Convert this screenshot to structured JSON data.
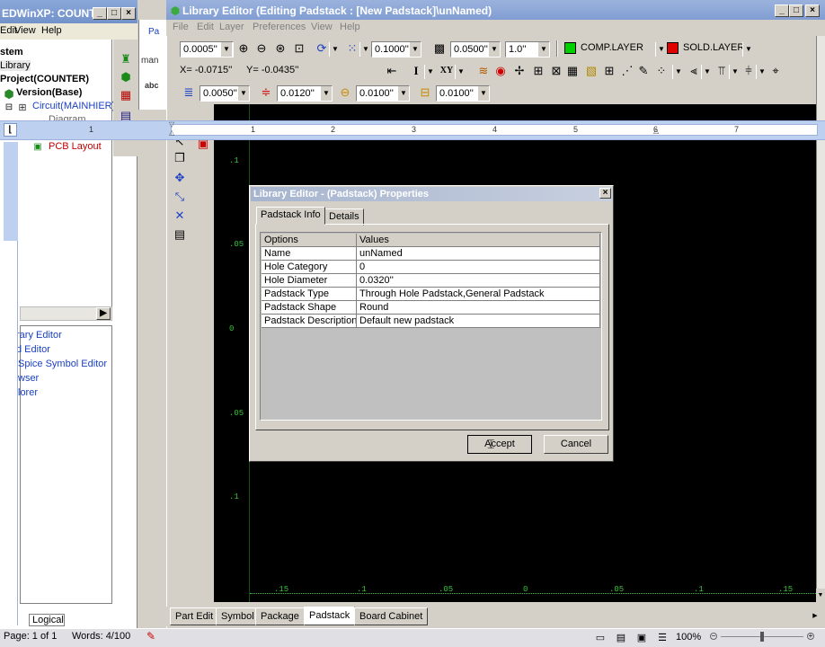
{
  "left_window": {
    "title": "EDWinXP: COUNTE...",
    "menu": [
      "Edit",
      "View",
      "Help"
    ],
    "tree": [
      {
        "label": "stem",
        "bold": true
      },
      {
        "label": "Library"
      },
      {
        "label": "Project(COUNTER)",
        "bold": true
      },
      {
        "label": "Version(Base)",
        "bold": true
      },
      {
        "label": "Circuit(MAINHIER)"
      },
      {
        "label": "Diagram"
      },
      {
        "label": "PCB Layout"
      }
    ],
    "tools": [
      {
        "label": "rary Editor"
      },
      {
        "label": "d Editor"
      },
      {
        "label": "Spice Symbol Editor"
      },
      {
        "label": "wser"
      },
      {
        "label": "lorer"
      }
    ],
    "side_labels": [
      "Pa",
      "man",
      "abc"
    ],
    "bottom_tab": "Logical"
  },
  "main_window": {
    "title": "Library Editor (Editing Padstack : [New Padstack]\\unNamed)",
    "menu": [
      "File",
      "Edit",
      "Layer",
      "Preferences",
      "View",
      "Help"
    ],
    "toolbar1": {
      "zoom_value": "0.0005''",
      "grid1": "0.1000''",
      "grid2": "0.0500''",
      "grid3": "1.0''",
      "layer1": "COMP.LAYER",
      "layer1_color": "#00d000",
      "layer2": "SOLD.LAYER",
      "layer2_color": "#e00000"
    },
    "coords": {
      "x": "X= -0.0715''",
      "y": "Y= -0.0435''"
    },
    "toolbar3": {
      "width": "0.0050''",
      "clearance": "0.0120''",
      "pad_x": "0.0100''",
      "pad_y": "0.0100''"
    },
    "vertical_ruler_labels": [
      ".1",
      ".05",
      "0",
      ".05",
      ".1"
    ],
    "horizontal_ruler_labels": [
      ".15",
      ".1",
      ".05",
      "0",
      ".05",
      ".1",
      ".15"
    ],
    "word_ruler_labels": [
      "1",
      "1",
      "2",
      "3",
      "4",
      "5",
      "6",
      "7"
    ],
    "tabs": [
      "Part Edit",
      "Symbol",
      "Package",
      "Padstack",
      "Board Cabinet"
    ],
    "active_tab": "Padstack"
  },
  "dialog": {
    "title": "Library Editor - (Padstack) Properties",
    "tabs": [
      "Padstack Info",
      "Details"
    ],
    "columns": [
      "Options",
      "Values"
    ],
    "rows": [
      {
        "option": "Name",
        "value": "unNamed"
      },
      {
        "option": "Hole Category",
        "value": "0"
      },
      {
        "option": "Hole Diameter",
        "value": "0.0320''"
      },
      {
        "option": "Padstack Type",
        "value": "Through Hole Padstack,General Padstack"
      },
      {
        "option": "Padstack Shape",
        "value": "Round"
      },
      {
        "option": "Padstack Description",
        "value": "Default new padstack"
      }
    ],
    "accept_label": "Accept",
    "cancel_label": "Cancel"
  },
  "status_bar": {
    "page": "Page: 1 of 1",
    "words": "Words: 4/100",
    "zoom": "100%"
  }
}
